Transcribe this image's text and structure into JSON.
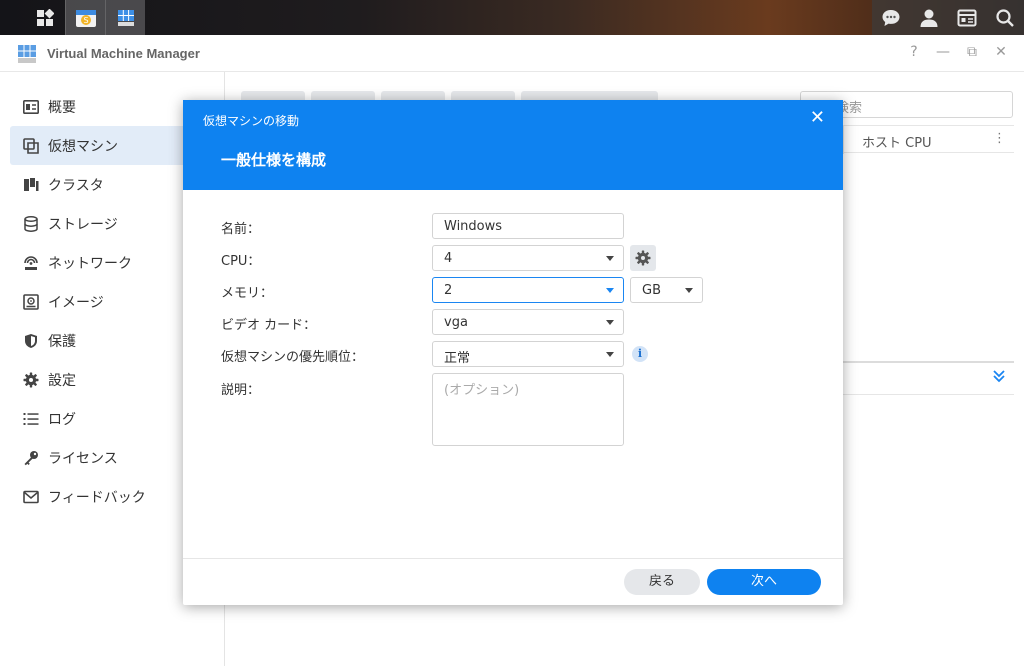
{
  "window": {
    "title": "Virtual Machine Manager",
    "controls": [
      "?",
      "—",
      "⧉",
      "✕"
    ]
  },
  "sidebar": {
    "items": [
      {
        "label": "概要",
        "icon": "overview-icon"
      },
      {
        "label": "仮想マシン",
        "icon": "virtual-machine-icon",
        "active": true
      },
      {
        "label": "クラスタ",
        "icon": "cluster-icon"
      },
      {
        "label": "ストレージ",
        "icon": "storage-icon"
      },
      {
        "label": "ネットワーク",
        "icon": "network-icon"
      },
      {
        "label": "イメージ",
        "icon": "image-icon"
      },
      {
        "label": "保護",
        "icon": "shield-icon"
      },
      {
        "label": "設定",
        "icon": "gear-icon"
      },
      {
        "label": "ログ",
        "icon": "log-list-icon"
      },
      {
        "label": "ライセンス",
        "icon": "key-icon"
      },
      {
        "label": "フィードバック",
        "icon": "mail-icon"
      }
    ]
  },
  "main": {
    "search_placeholder": "検索",
    "grid_column": "ホスト CPU",
    "more": "⋮"
  },
  "dialog": {
    "title": "仮想マシンの移動",
    "step_title": "一般仕様を構成",
    "close": "✕",
    "fields": {
      "name_label": "名前：",
      "name_value": "Windows",
      "cpu_label": "CPU：",
      "cpu_value": "4",
      "memory_label": "メモリ：",
      "memory_value": "2",
      "memory_unit": "GB",
      "video_label": "ビデオ カード：",
      "video_value": "vga",
      "priority_label": "仮想マシンの優先順位：",
      "priority_value": "正常",
      "description_label": "説明：",
      "description_placeholder": "(オプション)"
    },
    "info_glyph": "i",
    "buttons": {
      "back": "戻る",
      "next": "次へ"
    }
  },
  "colors": {
    "accent": "#0e82f0",
    "sidebar_active": "#e2ecf8"
  }
}
